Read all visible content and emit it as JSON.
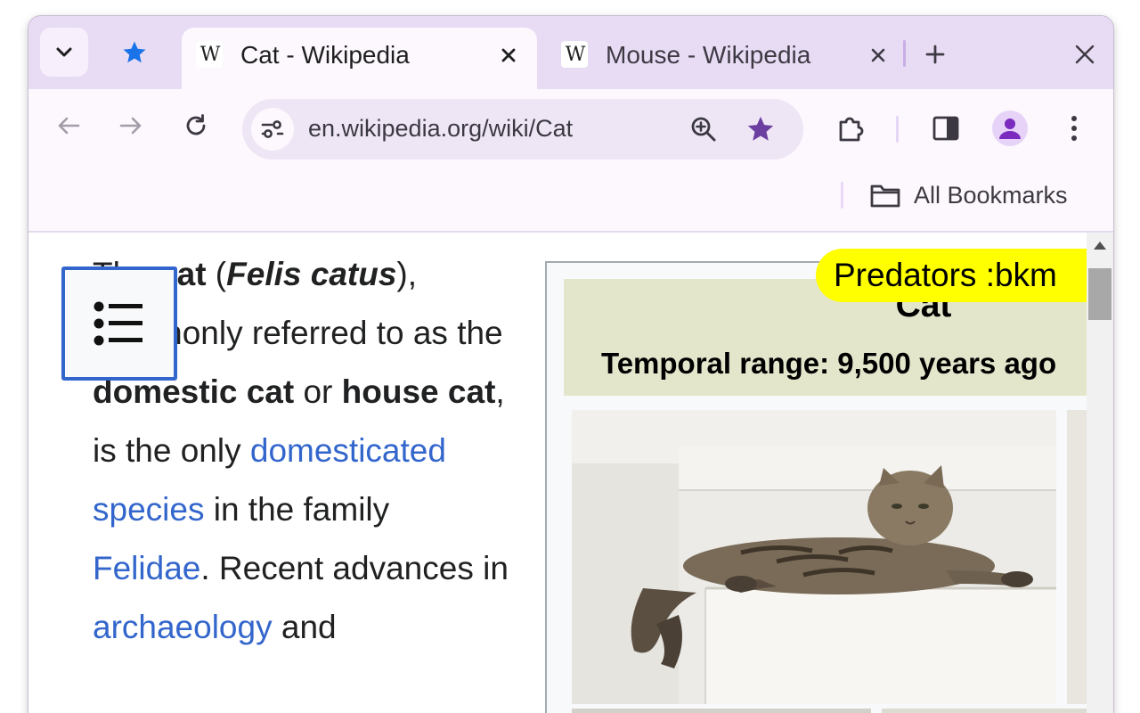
{
  "tabstrip": {
    "tabs": [
      {
        "title": "Cat - Wikipedia",
        "favicon": "W",
        "active": true
      },
      {
        "title": "Mouse - Wikipedia",
        "favicon": "W",
        "active": false
      }
    ],
    "icons": {
      "tab_search": "chevron-down-icon",
      "pinned": "star-icon",
      "new_tab": "plus-icon",
      "close_window": "close-icon"
    }
  },
  "toolbar": {
    "url": "en.wikipedia.org/wiki/Cat",
    "icons": [
      "back-arrow-icon",
      "forward-arrow-icon",
      "reload-icon",
      "site-info-icon",
      "zoom-icon",
      "bookmark-star-icon",
      "extensions-icon",
      "side-panel-icon",
      "profile-icon",
      "more-menu-icon"
    ]
  },
  "bookmarks": {
    "folder_label": "All Bookmarks"
  },
  "article": {
    "p1_before": "The ",
    "p1_bold1": "cat",
    "p1_paren_open": " (",
    "p1_italic": "Felis catus",
    "p1_paren_close": "),",
    "p1_text2": " commonly referred to as the ",
    "p1_bold2": "domestic cat",
    "p1_text3": " or ",
    "p1_bold3": "house cat",
    "p1_text4": ", is the only ",
    "link1": "domesticated species",
    "p1_text5": " in the family ",
    "link2": "Felidae",
    "p1_text6": ". Recent advances in ",
    "link3": "archaeology",
    "p1_text7": " and"
  },
  "infobox": {
    "title": "Cat",
    "temporal_range": "Temporal range: 9,500 years ago"
  },
  "highlight": {
    "text": "Predators :bkm"
  },
  "colors": {
    "tabstrip_bg": "#e8dcf4",
    "toolbar_bg": "#fcf8fe",
    "link": "#3366cc",
    "highlight": "#ffff00",
    "infobox_header": "#e4e6cc"
  }
}
